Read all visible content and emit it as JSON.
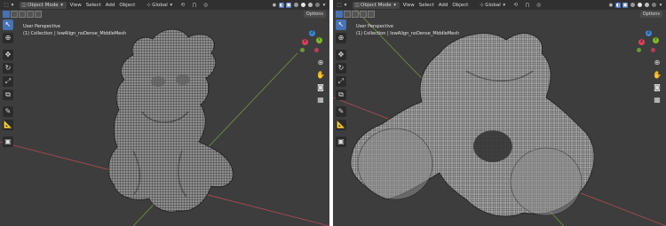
{
  "header": {
    "mode_label": "Object Mode",
    "menu": [
      "View",
      "Select",
      "Add",
      "Object"
    ],
    "transform_orientation": "Global"
  },
  "options_label": "Options",
  "overlay": {
    "view_name": "User Perspective",
    "collection_info": "(1) Collection | lowAlign_noDense_MiddleMesh"
  },
  "gizmo_axes": [
    "X",
    "Y",
    "Z"
  ],
  "icons": {
    "editor_type": "cube-editor-icon",
    "transform_orientation": "axis-icon",
    "pivot": "pivot-icon",
    "snap": "magnet-icon",
    "proportional": "proportional-edit-icon",
    "view_object_types": "eye-icon",
    "overlays": "overlays-icon",
    "xray": "xray-icon",
    "shading": [
      "wireframe-shading-icon",
      "solid-shading-icon",
      "material-shading-icon",
      "rendered-shading-icon"
    ],
    "tools": [
      "select-cursor-icon",
      "cursor-3d-icon",
      "move-icon",
      "rotate-icon",
      "scale-icon",
      "transform-icon",
      "annotate-icon",
      "measure-icon",
      "add-cube-icon"
    ],
    "nav": [
      "zoom-icon",
      "hand-pan-icon",
      "camera-icon",
      "grid-view-icon"
    ]
  },
  "colors": {
    "viewport_bg": "#3d3d3d",
    "header_bg": "#303030",
    "accent": "#4772b3",
    "axis_x": "#e0415c",
    "axis_y": "#7cba2a",
    "axis_z": "#3b87d6"
  }
}
